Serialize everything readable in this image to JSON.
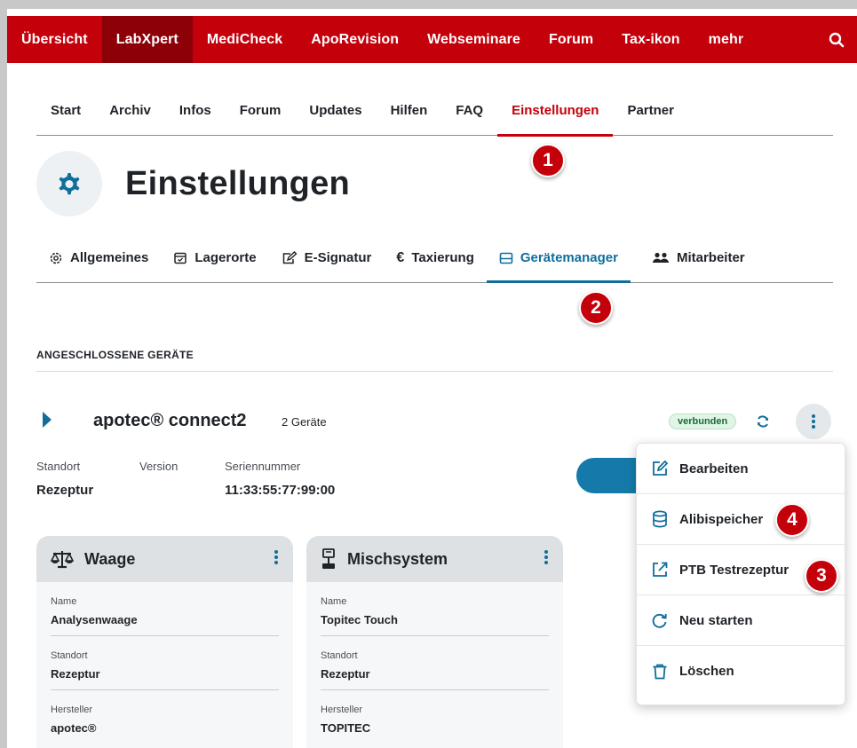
{
  "top_nav": {
    "items": [
      "Übersicht",
      "LabXpert",
      "MediCheck",
      "ApoRevision",
      "Webseminare",
      "Forum",
      "Tax-ikon",
      "mehr"
    ],
    "active_index": 1
  },
  "sub_nav": {
    "items": [
      "Start",
      "Archiv",
      "Infos",
      "Forum",
      "Updates",
      "Hilfen",
      "FAQ",
      "Einstellungen",
      "Partner"
    ],
    "active_index": 7
  },
  "page": {
    "title": "Einstellungen",
    "icon": "gear-icon"
  },
  "tabs": [
    {
      "label": "Allgemeines",
      "icon": "gear-outline-icon"
    },
    {
      "label": "Lagerorte",
      "icon": "box-icon"
    },
    {
      "label": "E-Signatur",
      "icon": "signature-icon"
    },
    {
      "label": "Taxierung",
      "icon": "euro-icon"
    },
    {
      "label": "Gerätemanager",
      "icon": "device-icon"
    },
    {
      "label": "Mitarbeiter",
      "icon": "users-icon"
    }
  ],
  "active_tab_index": 4,
  "section": {
    "title": "ANGESCHLOSSENE GERÄTE"
  },
  "device": {
    "name": "apotec® connect2",
    "count": "2 Geräte",
    "status": "verbunden",
    "standort_label": "Standort",
    "standort_value": "Rezeptur",
    "version_label": "Version",
    "serial_label": "Seriennummer",
    "serial_value": "11:33:55:77:99:00"
  },
  "cards": [
    {
      "title": "Waage",
      "icon": "scale-icon",
      "fields": [
        {
          "label": "Name",
          "value": "Analysenwaage"
        },
        {
          "label": "Standort",
          "value": "Rezeptur"
        },
        {
          "label": "Hersteller",
          "value": "apotec®"
        }
      ]
    },
    {
      "title": "Mischsystem",
      "icon": "mixer-icon",
      "fields": [
        {
          "label": "Name",
          "value": "Topitec Touch"
        },
        {
          "label": "Standort",
          "value": "Rezeptur"
        },
        {
          "label": "Hersteller",
          "value": "TOPITEC"
        }
      ]
    }
  ],
  "menu": {
    "items": [
      {
        "label": "Bearbeiten",
        "icon": "edit-icon"
      },
      {
        "label": "Alibispeicher",
        "icon": "database-icon"
      },
      {
        "label": "PTB Testrezeptur",
        "icon": "external-link-icon"
      },
      {
        "label": "Neu starten",
        "icon": "restart-icon"
      },
      {
        "label": "Löschen",
        "icon": "trash-icon"
      }
    ]
  },
  "markers": [
    "1",
    "2",
    "3",
    "4"
  ],
  "colors": {
    "brand_red": "#c4000b",
    "brand_red_dark": "#8e0008",
    "accent_blue": "#0f6e9c",
    "status_green": "#1a6b34"
  }
}
